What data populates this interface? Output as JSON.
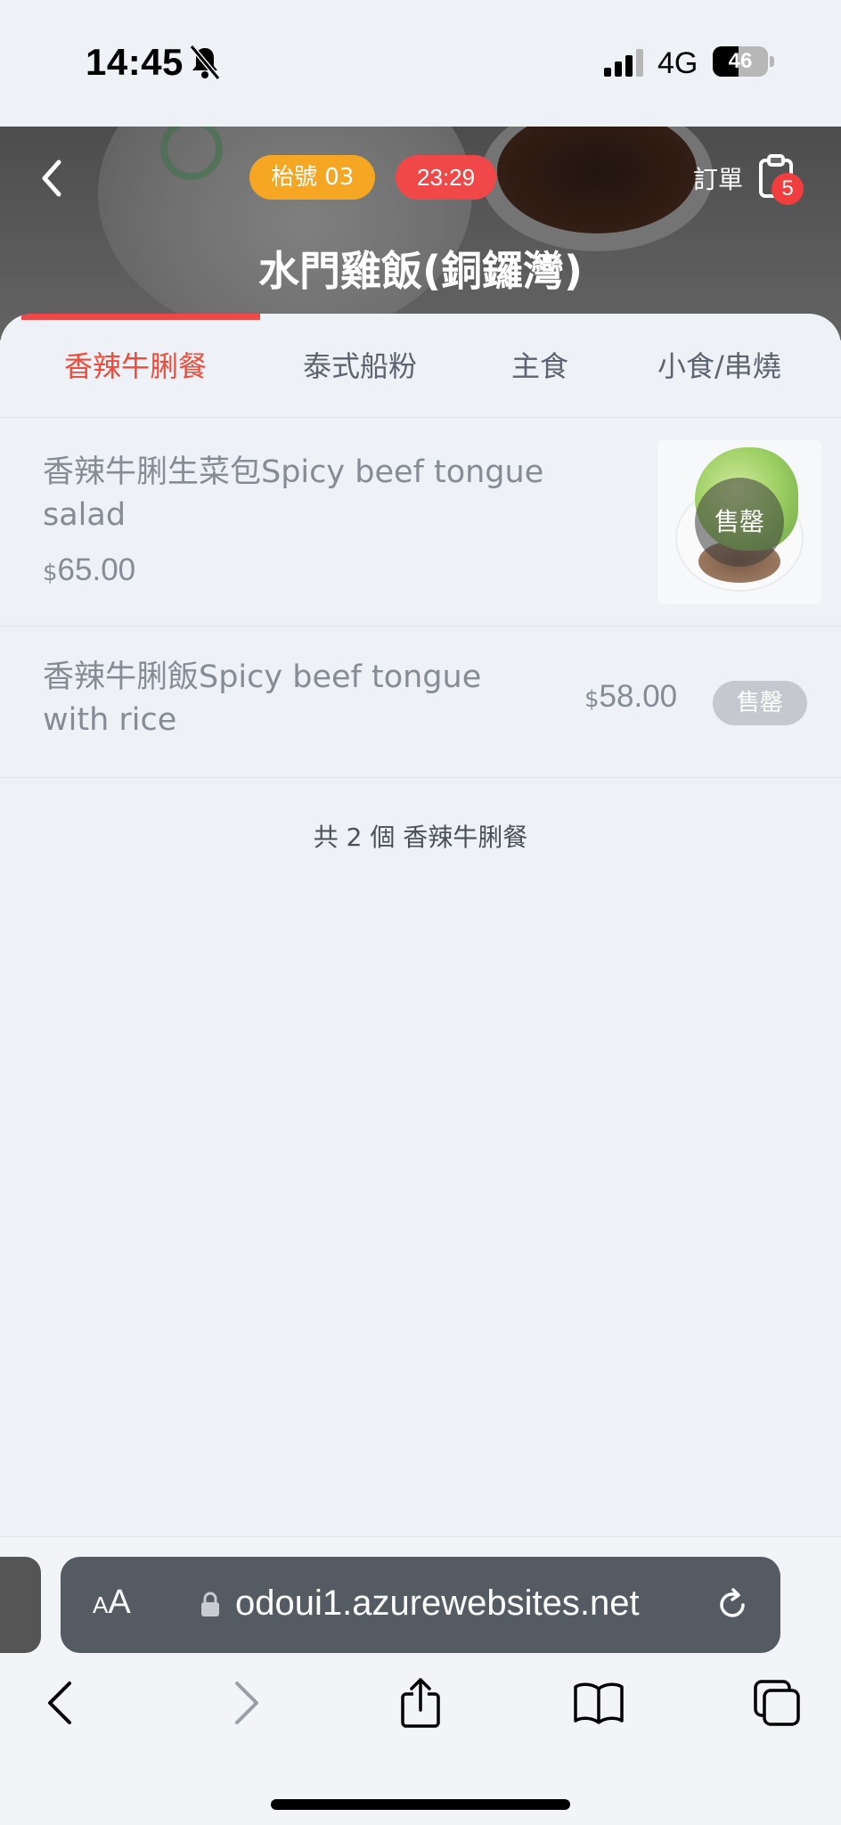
{
  "status_bar": {
    "time": "14:45",
    "network": "4G",
    "battery": "46",
    "battery_level": 0.46
  },
  "header": {
    "table_badge": "枱號  03",
    "timer": "23:29",
    "order_label": "訂單",
    "order_count": "5",
    "store_title": "水門雞飯(銅鑼灣)"
  },
  "tabs": [
    {
      "label": "香辣牛脷餐",
      "active": true
    },
    {
      "label": "泰式船粉",
      "active": false
    },
    {
      "label": "主食",
      "active": false
    },
    {
      "label": "小食/串燒",
      "active": false
    }
  ],
  "items": [
    {
      "name_line1": "香辣牛脷生菜包Spicy beef tongue",
      "name_line2": "salad",
      "currency": "$",
      "price": "65.00",
      "status": "售罄"
    },
    {
      "name_line1": "香辣牛脷飯Spicy beef tongue",
      "name_line2": "with rice",
      "currency": "$",
      "price": "58.00",
      "status": "售罄"
    }
  ],
  "summary": "共 2 個 香辣牛脷餐",
  "browser": {
    "aa_label_small": "A",
    "aa_label_large": "A",
    "url": "odoui1.azurewebsites.net"
  },
  "colors": {
    "accent_red": "#ee4b3b",
    "badge_orange": "#f5a623",
    "timer_red": "#f04848"
  }
}
